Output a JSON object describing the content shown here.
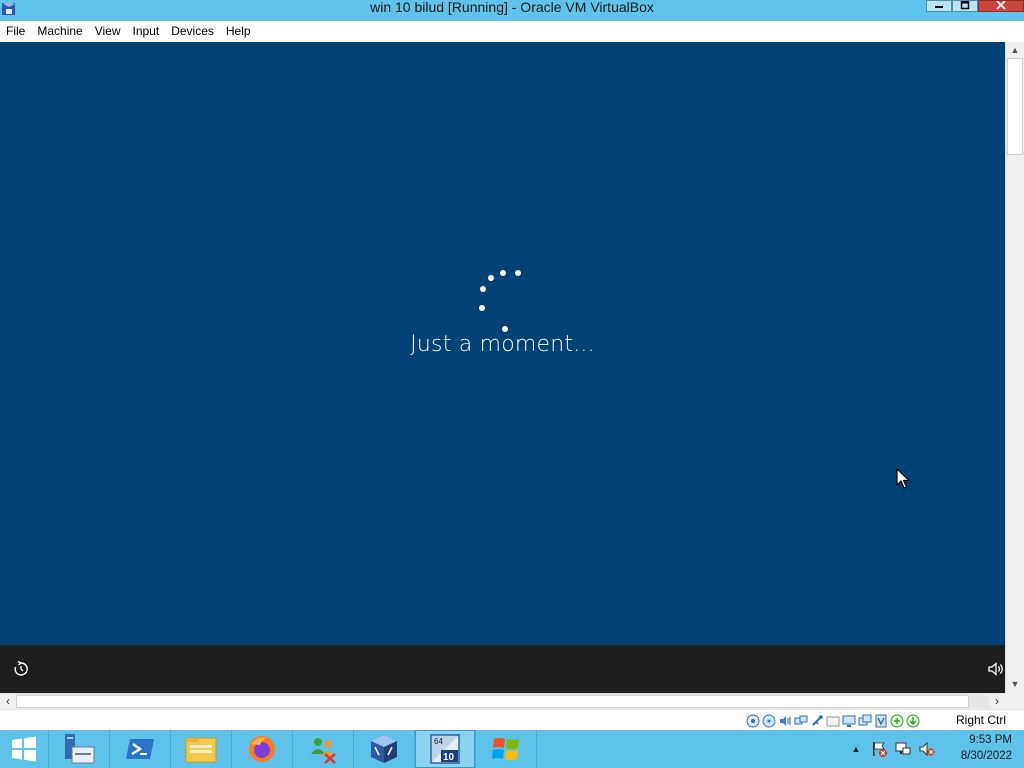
{
  "window": {
    "title": "win 10 bilud [Running] - Oracle VM VirtualBox",
    "minimize_icon": "minimize-icon",
    "maximize_icon": "maximize-icon",
    "close_icon": "close-icon"
  },
  "menu": {
    "items": [
      "File",
      "Machine",
      "View",
      "Input",
      "Devices",
      "Help"
    ]
  },
  "guest": {
    "status_text": "Just a moment...",
    "background_color": "#004275",
    "bottom_bar_color": "#1e1e1e",
    "power_icon": "ease-of-access-icon",
    "volume_icon": "volume-icon"
  },
  "statusbar": {
    "device_icons": [
      "hard-disk-icon",
      "optical-drive-icon",
      "audio-icon",
      "network-icon",
      "usb-icon",
      "shared-folder-icon",
      "display-icon",
      "video-capture-icon",
      "cpu-icon",
      "mouse-integration-icon",
      "keyboard-icon"
    ],
    "host_key": "Right Ctrl"
  },
  "taskbar": {
    "color": "#5ec2ea",
    "pinned": [
      {
        "name": "server-manager-icon"
      },
      {
        "name": "powershell-icon"
      },
      {
        "name": "file-explorer-icon"
      },
      {
        "name": "firefox-icon"
      },
      {
        "name": "network-users-icon"
      },
      {
        "name": "virtualbox-icon"
      },
      {
        "name": "windows10-vm-icon",
        "badge_top": "64",
        "badge_bottom": "10",
        "active": true
      },
      {
        "name": "windows-xp-icon"
      }
    ],
    "tray_icons": [
      "show-hidden-icons-chevron",
      "action-center-flag-icon",
      "network-icon",
      "volume-muted-icon"
    ],
    "time": "9:53 PM",
    "date": "8/30/2022"
  }
}
